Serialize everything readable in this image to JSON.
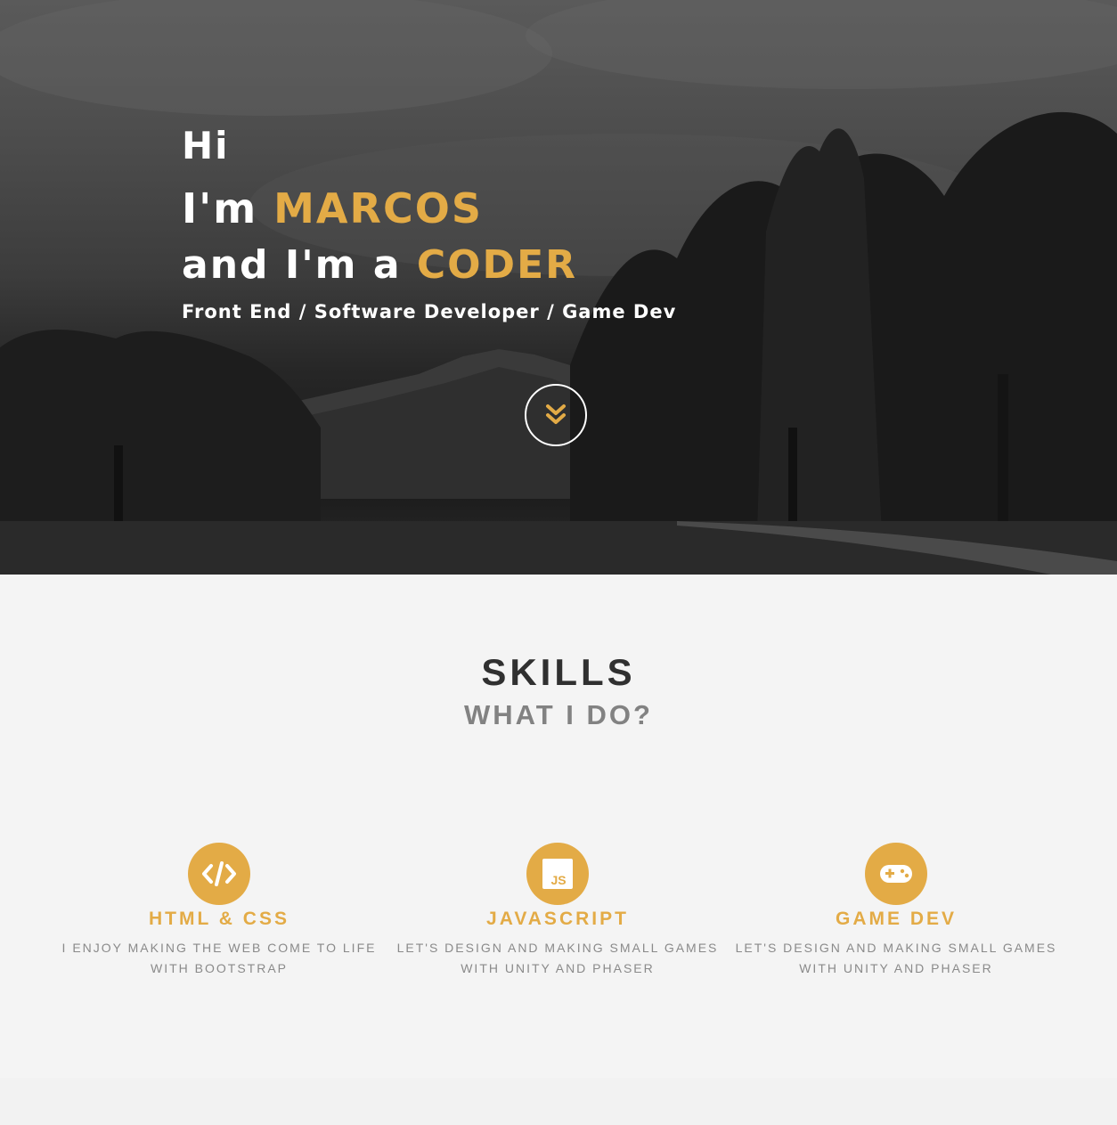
{
  "hero": {
    "greeting": "Hi",
    "intro_prefix": "I'm",
    "name": "MARCOS",
    "role_prefix": "and I'm a",
    "role": "CODER",
    "subtitle": "Front End / Software Developer / Game Dev",
    "scroll_icon": "chevron-double-down-icon"
  },
  "skills": {
    "title": "SKILLS",
    "subtitle": "WHAT I DO?",
    "items": [
      {
        "icon": "code-icon",
        "title": "HTML & CSS",
        "desc_line1": "I enjoy making the web come to life",
        "desc_line2": "with bootstrap"
      },
      {
        "icon": "javascript-icon",
        "title": "JAVASCRIPT",
        "desc_line1": "Let's design and making small games",
        "desc_line2": "with Unity and Phaser"
      },
      {
        "icon": "gamepad-icon",
        "title": "GAME DEV",
        "desc_line1": "Let's design and making small games",
        "desc_line2": "with Unity and Phaser"
      }
    ]
  },
  "colors": {
    "accent": "#e3ab46",
    "heading": "#303030",
    "subheading": "#828282",
    "background": "#f4f4f4"
  }
}
